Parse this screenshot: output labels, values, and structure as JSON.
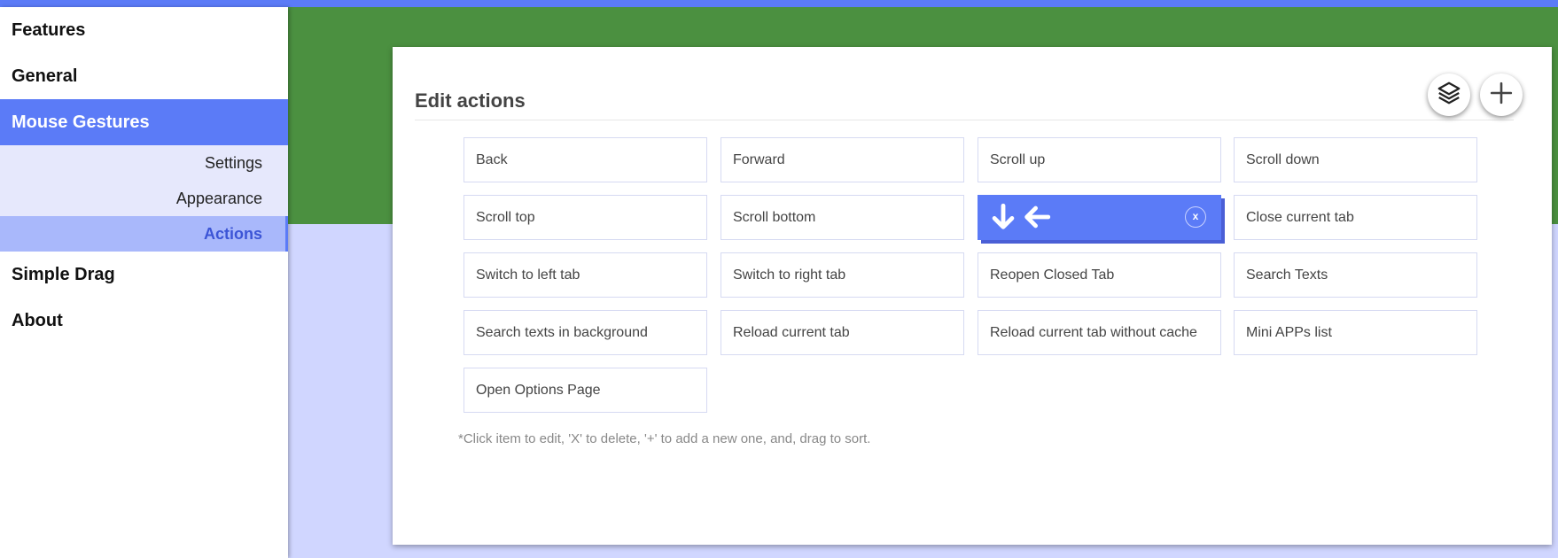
{
  "sidebar": {
    "sections": [
      {
        "label": "Features"
      },
      {
        "label": "General"
      },
      {
        "label": "Mouse Gestures"
      },
      {
        "label": "Simple Drag"
      },
      {
        "label": "About"
      }
    ],
    "mouse_gestures_subitems": [
      {
        "label": "Settings"
      },
      {
        "label": "Appearance"
      },
      {
        "label": "Actions"
      }
    ]
  },
  "card": {
    "title": "Edit actions",
    "buttons": {
      "layers_icon": "layers-icon",
      "add_icon": "plus-icon"
    },
    "actions": [
      {
        "label": "Back"
      },
      {
        "label": "Forward"
      },
      {
        "label": "Scroll up"
      },
      {
        "label": "Scroll down"
      },
      {
        "label": "Scroll top"
      },
      {
        "label": "Scroll bottom"
      },
      {
        "gesture": "down-left",
        "close_label": "x"
      },
      {
        "label": "Close current tab"
      },
      {
        "label": "Switch to left tab"
      },
      {
        "label": "Switch to right tab"
      },
      {
        "label": "Reopen Closed Tab"
      },
      {
        "label": "Search Texts"
      },
      {
        "label": "Search texts in background"
      },
      {
        "label": "Reload current tab"
      },
      {
        "label": "Reload current tab without cache"
      },
      {
        "label": "Mini APPs list"
      },
      {
        "label": "Open Options Page"
      }
    ],
    "hint": "*Click item to edit, 'X' to delete, '+' to add a new one, and, drag to sort."
  },
  "colors": {
    "accent": "#5b7bf7",
    "green_band": "#4b9040",
    "background": "#d0d6ff"
  }
}
